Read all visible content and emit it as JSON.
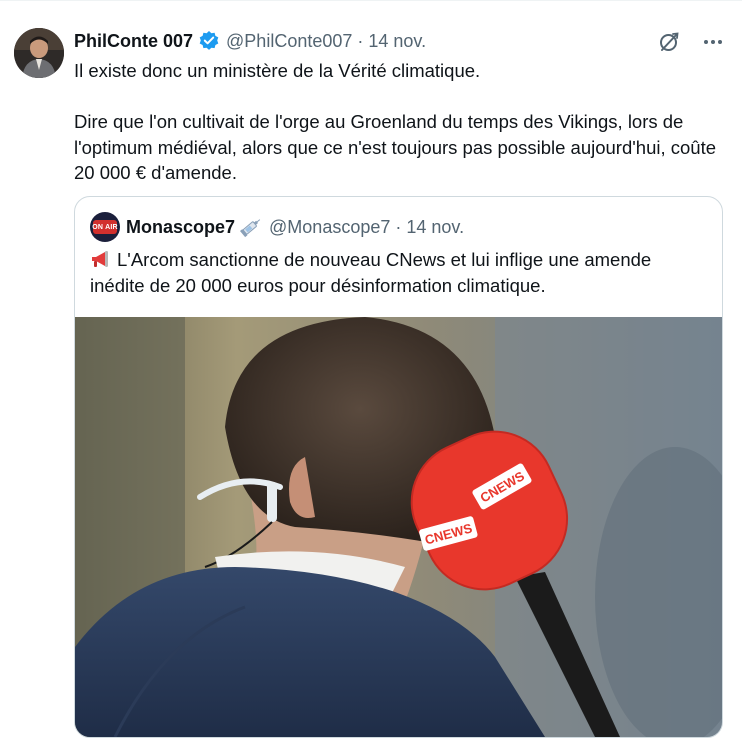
{
  "tweet": {
    "author_name": "PhilConte 007",
    "author_handle": "@PhilConte007",
    "separator": "·",
    "date": "14 nov.",
    "text": "Il existe donc un ministère de la Vérité climatique.\n\nDire que l'on cultivait de l'orge au Groenland du temps des Vikings, lors de l'optimum médiéval, alors que ce n'est toujours pas possible aujourd'hui, coûte 20 000 € d'amende."
  },
  "quoted": {
    "author_name": "Monascope7",
    "author_handle": "@Monascope7",
    "separator": "·",
    "date": "14 nov.",
    "avatar_text": "ON AIR",
    "text": "L'Arcom sanctionne de nouveau CNews et lui inflige une amende inédite de 20 000 euros pour désinformation climatique.",
    "mic_logo_text_1": "CNEWS",
    "mic_logo_text_2": "CNEWS"
  },
  "colors": {
    "verified_blue": "#1d9bf0",
    "secondary_text": "#536471",
    "mic_red": "#e8372c"
  },
  "icons": {
    "grok": "grok-icon",
    "more": "more-icon",
    "verified": "verified-badge-icon",
    "megaphone": "megaphone-icon",
    "syringe": "syringe-icon"
  }
}
